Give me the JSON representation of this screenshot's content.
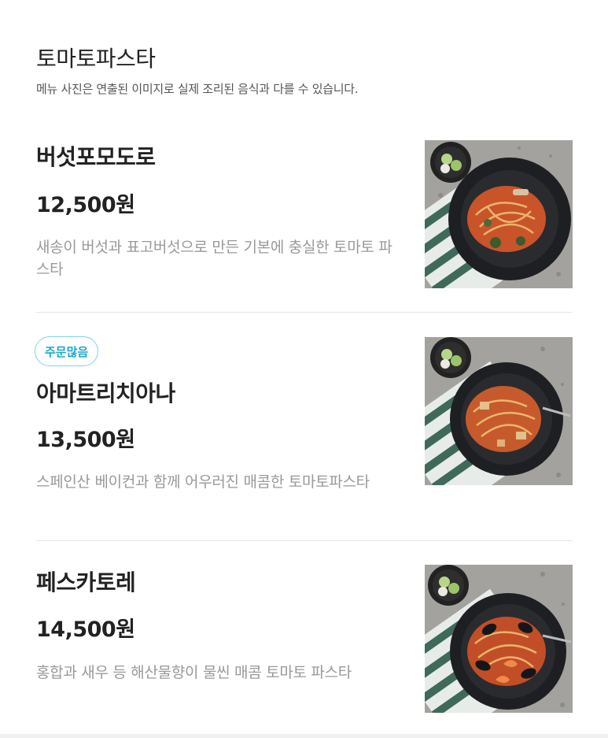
{
  "section": {
    "title": "토마토파스타",
    "note": "메뉴 사진은 연출된 이미지로 실제 조리된 음식과 다를 수 있습니다."
  },
  "items": [
    {
      "name": "버섯포모도로",
      "price": "12,500원",
      "description": "새송이 버섯과 표고버섯으로 만든 기본에 충실한 토마토 파스타",
      "badge": "",
      "image": "mushroom-pomodoro-pasta-photo"
    },
    {
      "name": "아마트리치아나",
      "price": "13,500원",
      "description": "스페인산 베이컨과 함께 어우러진 매콤한 토마토파스타",
      "badge": "주문많음",
      "image": "amatriciana-pasta-photo"
    },
    {
      "name": "페스카토레",
      "price": "14,500원",
      "description": "홍합과 새우 등 해산물향이 물씬 매콤 토마토 파스타",
      "badge": "",
      "image": "pescatore-pasta-photo"
    }
  ],
  "colors": {
    "badge_text": "#1aa7c9",
    "badge_border": "#7fd3e6",
    "description": "#999999"
  }
}
